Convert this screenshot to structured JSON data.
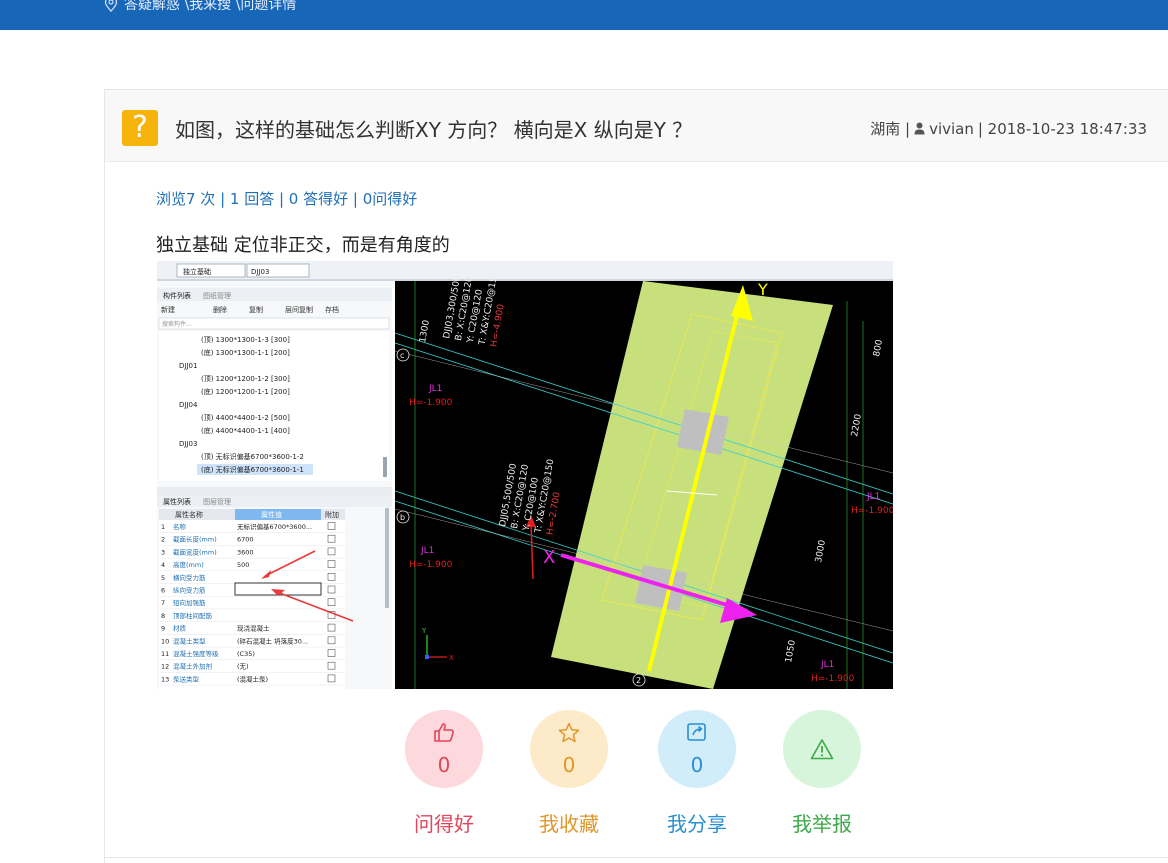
{
  "breadcrumb": "答疑解惑 \\我来搜 \\问题详情",
  "question": {
    "title": "如图，这样的基础怎么判断XY 方向？ 横向是X 纵向是Y ？",
    "region": "湖南 |",
    "user": "vivian",
    "datetime": "| 2018-10-23 18:47:33",
    "stats": "浏览7 次 | 1 回答 | 0 答得好 | 0问得好",
    "body": "独立基础  定位非正交，而是有角度的"
  },
  "screenshot": {
    "dropdowns": [
      "独立基础",
      "DJJ03"
    ],
    "tabs1": [
      "构件列表",
      "图纸管理"
    ],
    "toolbar": [
      "新建",
      "删除",
      "复制",
      "层间复制",
      "存档"
    ],
    "search_placeholder": "搜索构件...",
    "tree": [
      "(顶) 1300*1300-1-3 [300]",
      "(底) 1300*1300-1-1 [200]",
      "DJJ01",
      "(顶) 1200*1200-1-2 [300]",
      "(底) 1200*1200-1-1 [200]",
      "DJJ04",
      "(顶) 4400*4400-1-2 [500]",
      "(底) 4400*4400-1-1 [400]",
      "DJJ03",
      "(顶) 无标识偏基6700*3600-1-2",
      "(底) 无标识偏基6700*3600-1-1"
    ],
    "tabs2": [
      "属性列表",
      "图层管理"
    ],
    "prop_headers": [
      "属性名称",
      "属性值",
      "附加"
    ],
    "props": [
      [
        "1",
        "名称",
        "无标识偏基6700*3600..."
      ],
      [
        "2",
        "截面长度(mm)",
        "6700"
      ],
      [
        "3",
        "截面宽度(mm)",
        "3600"
      ],
      [
        "4",
        "高度(mm)",
        "500"
      ],
      [
        "5",
        "横向受力筋",
        ""
      ],
      [
        "6",
        "纵向受力筋",
        ""
      ],
      [
        "7",
        "短向加强筋",
        ""
      ],
      [
        "8",
        "顶部柱间配筋",
        ""
      ],
      [
        "9",
        "材质",
        "现浇混凝土"
      ],
      [
        "10",
        "混凝土类型",
        "(碎石混凝土 坍落度30..."
      ],
      [
        "11",
        "混凝土强度等级",
        "(C35)"
      ],
      [
        "12",
        "混凝土外加剂",
        "(无)"
      ],
      [
        "13",
        "泵送类型",
        "(混凝土泵)"
      ]
    ],
    "cad_left_text": [
      "DJJ03,300/500",
      "B: X:C20@120",
      "Y: C20@120",
      "T: X&Y:C20@150",
      "H=-4.900"
    ],
    "cad_mid_text": [
      "DJJ05,500/500",
      "B: X:C20@120",
      "Y: C20@100",
      "T: X&Y:C20@150",
      "H=-2.700"
    ],
    "cad_labels": [
      "JL1",
      "H=-1.900",
      "JL1",
      "H=-1.900",
      "JL1",
      "H=-1.900",
      "JL1",
      "H=-1.900"
    ],
    "cad_dims": [
      "1300",
      "800",
      "2200",
      "3000",
      "1050"
    ],
    "axis_labels": [
      "c",
      "b",
      "2"
    ],
    "big_y": "Y",
    "big_x": "X",
    "ucs_x": "X",
    "ucs_y": "Y"
  },
  "actions": [
    {
      "icon": "thumbs-up-icon",
      "count": "0",
      "label": "问得好",
      "color": "#e2465a"
    },
    {
      "icon": "star-icon",
      "count": "0",
      "label": "我收藏",
      "color": "#e0972a"
    },
    {
      "icon": "share-icon",
      "count": "0",
      "label": "我分享",
      "color": "#2a8fcf"
    },
    {
      "icon": "warning-icon",
      "count": "",
      "label": "我举报",
      "color": "#3fa84a"
    }
  ]
}
